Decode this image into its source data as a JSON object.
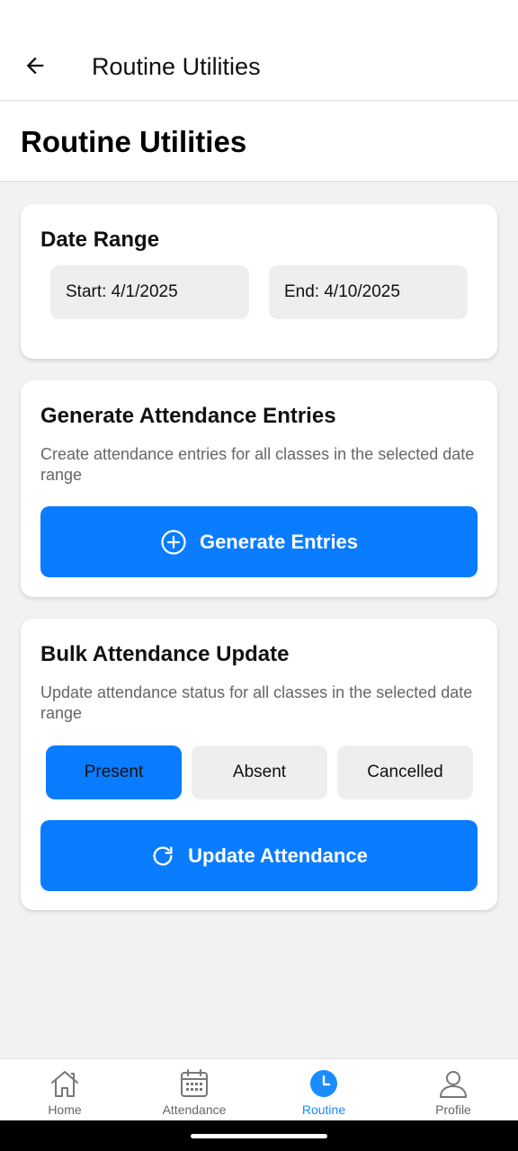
{
  "appbar": {
    "title": "Routine Utilities"
  },
  "page": {
    "title": "Routine Utilities"
  },
  "date_range": {
    "title": "Date Range",
    "start": "Start: 4/1/2025",
    "end": "End: 4/10/2025"
  },
  "generate": {
    "title": "Generate Attendance Entries",
    "description": "Create attendance entries for all classes in the selected date range",
    "button_label": "Generate Entries",
    "button_icon": "plus-circle-icon"
  },
  "bulk": {
    "title": "Bulk Attendance Update",
    "description": "Update attendance status for all classes in the selected date range",
    "options": [
      "Present",
      "Absent",
      "Cancelled"
    ],
    "selected": "Present",
    "button_label": "Update Attendance",
    "button_icon": "refresh-icon"
  },
  "nav": {
    "items": [
      {
        "label": "Home",
        "icon": "home-icon"
      },
      {
        "label": "Attendance",
        "icon": "calendar-icon"
      },
      {
        "label": "Routine",
        "icon": "clock-icon"
      },
      {
        "label": "Profile",
        "icon": "person-icon"
      }
    ],
    "active": "Routine"
  },
  "colors": {
    "primary": "#0a7cff",
    "active_nav": "#1a8cff",
    "chip_bg": "#eeeeee",
    "background": "#f2f2f2"
  }
}
